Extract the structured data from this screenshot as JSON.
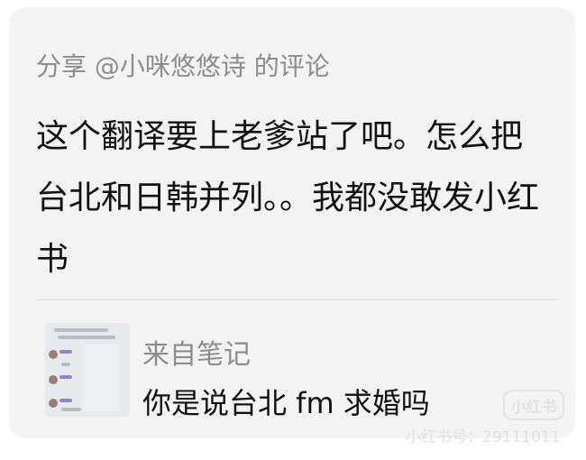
{
  "header": {
    "share_text": "分享 @小咪悠悠诗 的评论"
  },
  "comment": {
    "text": "这个翻译要上老爹站了吧。怎么把台北和日韩并列。。我都没敢发小红书"
  },
  "note": {
    "source_label": "来自笔记",
    "excerpt": "你是说台北 fm 求婚吗"
  },
  "watermark": {
    "logo_text": "小红书",
    "id_text": "小红书号：29111011"
  }
}
